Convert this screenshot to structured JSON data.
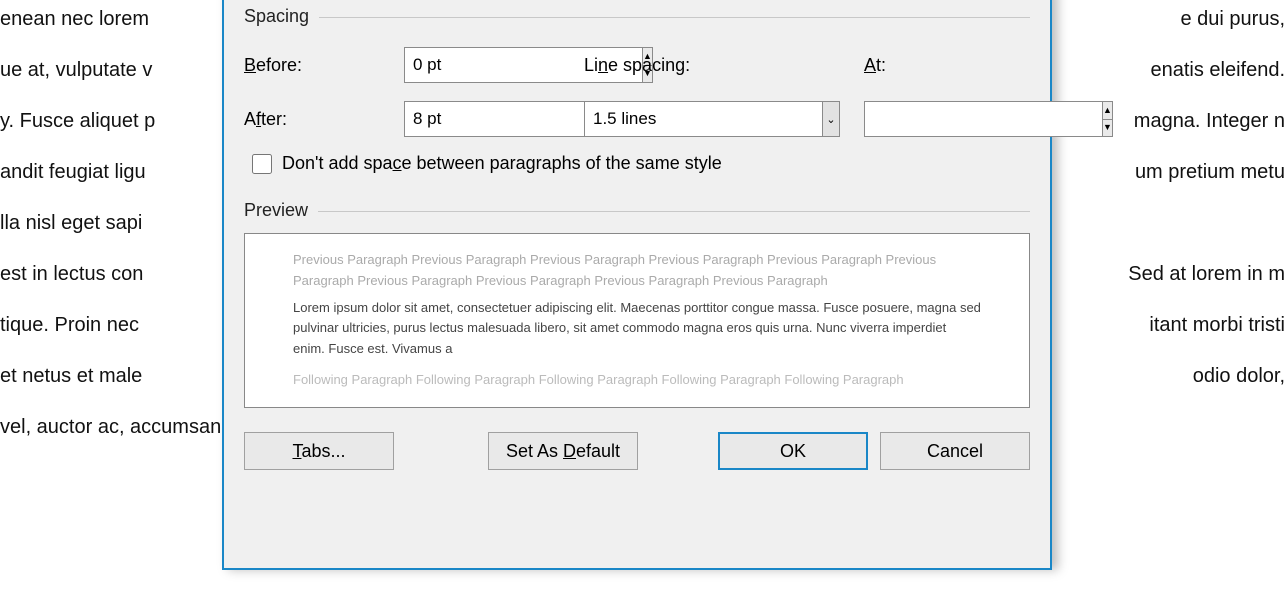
{
  "background_lines": [
    "enean nec lorem",
    "ue at, vulputate v",
    "y. Fusce aliquet p",
    "andit feugiat ligu",
    "lla nisl eget sapi",
    "",
    "est in lectus con",
    "tique. Proin nec ",
    "et netus et male",
    "vel, auctor ac, accumsan id, felis."
  ],
  "background_right": [
    "e dui purus,",
    "enatis eleifend.",
    "magna. Integer n",
    "um pretium metu",
    "",
    "",
    "Sed at lorem in m",
    "itant morbi tristi",
    " odio dolor,",
    ""
  ],
  "dialog": {
    "spacing": {
      "group_label": "Spacing",
      "before_label": "Before:",
      "before_value": "0 pt",
      "after_label": "After:",
      "after_value": "8 pt",
      "line_spacing_label": "Line spacing:",
      "line_spacing_value": "1.5 lines",
      "at_label": "At:",
      "at_value": "",
      "checkbox_label": "Don't add space between paragraphs of the same style"
    },
    "preview": {
      "group_label": "Preview",
      "previous_text": "Previous Paragraph Previous Paragraph Previous Paragraph Previous Paragraph Previous Paragraph Previous Paragraph Previous Paragraph Previous Paragraph Previous Paragraph Previous Paragraph",
      "sample_text": "Lorem ipsum dolor sit amet, consectetuer adipiscing elit. Maecenas porttitor congue massa. Fusce posuere, magna sed pulvinar ultricies, purus lectus malesuada libero, sit amet commodo magna eros quis urna. Nunc viverra imperdiet enim. Fusce est. Vivamus a",
      "following_text": "Following Paragraph Following Paragraph Following Paragraph Following Paragraph Following Paragraph"
    },
    "buttons": {
      "tabs": "Tabs...",
      "default": "Set As Default",
      "ok": "OK",
      "cancel": "Cancel"
    }
  }
}
